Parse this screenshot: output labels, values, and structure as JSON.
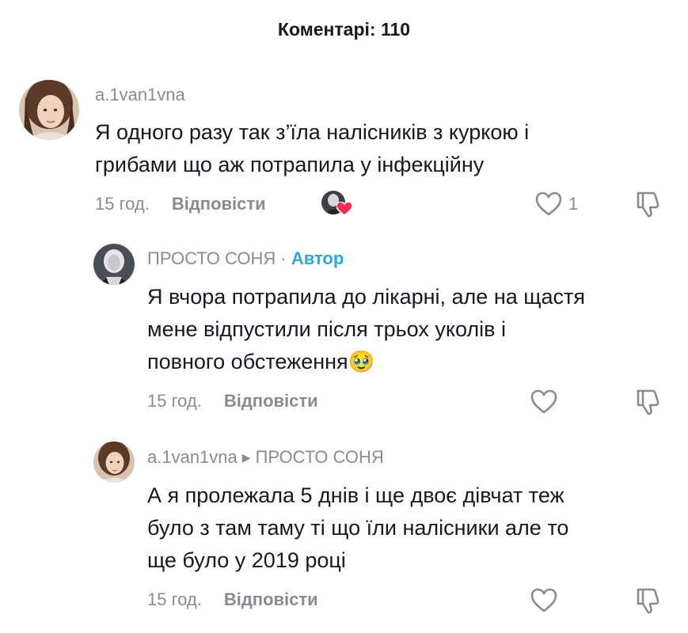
{
  "header": {
    "title": "Коментарі: 110"
  },
  "comments": [
    {
      "username": "a.1van1vna",
      "text_line1": "Я одного разу так з’їла налісників з куркою і",
      "text_line2": "грибами що аж потрапила у інфекційну",
      "time": "15 год.",
      "reply_label": "Відповісти",
      "like_count": "1",
      "liked_by_creator": true
    },
    {
      "username": "ПРОСТО СОНЯ",
      "separator": "·",
      "author_badge": "Автор",
      "text_line1": "Я вчора потрапила до лікарні, але на щастя",
      "text_line2": "мене відпустили після трьох уколів і",
      "text_line3": "повного обстеження",
      "emoji": "🥹",
      "time": "15 год.",
      "reply_label": "Відповісти"
    },
    {
      "username": "a.1van1vna",
      "reply_to": "ПРОСТО СОНЯ",
      "text_line1": "А я пролежала 5 днів і ще двоє дівчат теж",
      "text_line2": "було з там таму ті що їли налісники але то",
      "text_line3": "ще було у 2019 році",
      "time": "15 год.",
      "reply_label": "Відповісти"
    }
  ],
  "colors": {
    "text": "#161823",
    "muted": "#8a8b91",
    "author": "#2aa8e0",
    "heart": "#fe2c55"
  }
}
